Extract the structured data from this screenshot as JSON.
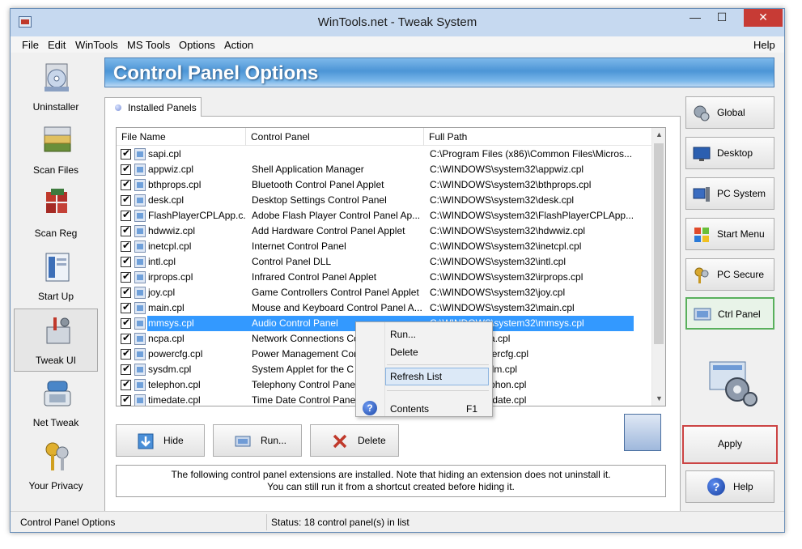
{
  "window": {
    "title": "WinTools.net - Tweak System",
    "min_glyph": "—",
    "max_glyph": "☐",
    "close_glyph": "✕"
  },
  "menu": {
    "items": [
      "File",
      "Edit",
      "WinTools",
      "MS Tools",
      "Options",
      "Action"
    ],
    "help": "Help"
  },
  "nav": {
    "items": [
      {
        "label": "Uninstaller",
        "icon": "uninstaller-icon"
      },
      {
        "label": "Scan Files",
        "icon": "scan-files-icon"
      },
      {
        "label": "Scan Reg",
        "icon": "scan-reg-icon"
      },
      {
        "label": "Start Up",
        "icon": "start-up-icon"
      },
      {
        "label": "Tweak UI",
        "icon": "tweak-ui-icon"
      },
      {
        "label": "Net Tweak",
        "icon": "net-tweak-icon"
      },
      {
        "label": "Your Privacy",
        "icon": "your-privacy-icon"
      }
    ],
    "active": "Tweak UI"
  },
  "banner": {
    "title": "Control Panel Options"
  },
  "tab": {
    "label": "Installed Panels"
  },
  "list": {
    "columns": [
      "File Name",
      "Control Panel",
      "Full Path"
    ],
    "rows": [
      {
        "name": "sapi.cpl",
        "cp": "",
        "path": "C:\\Program Files (x86)\\Common Files\\Micros..."
      },
      {
        "name": "appwiz.cpl",
        "cp": "Shell Application Manager",
        "path": "C:\\WINDOWS\\system32\\appwiz.cpl"
      },
      {
        "name": "bthprops.cpl",
        "cp": "Bluetooth Control Panel Applet",
        "path": "C:\\WINDOWS\\system32\\bthprops.cpl"
      },
      {
        "name": "desk.cpl",
        "cp": "Desktop Settings Control Panel",
        "path": "C:\\WINDOWS\\system32\\desk.cpl"
      },
      {
        "name": "FlashPlayerCPLApp.c...",
        "cp": "Adobe Flash Player Control Panel Ap...",
        "path": "C:\\WINDOWS\\system32\\FlashPlayerCPLApp...."
      },
      {
        "name": "hdwwiz.cpl",
        "cp": "Add Hardware Control Panel Applet",
        "path": "C:\\WINDOWS\\system32\\hdwwiz.cpl"
      },
      {
        "name": "inetcpl.cpl",
        "cp": "Internet Control Panel",
        "path": "C:\\WINDOWS\\system32\\inetcpl.cpl"
      },
      {
        "name": "intl.cpl",
        "cp": "Control Panel DLL",
        "path": "C:\\WINDOWS\\system32\\intl.cpl"
      },
      {
        "name": "irprops.cpl",
        "cp": "Infrared Control Panel Applet",
        "path": "C:\\WINDOWS\\system32\\irprops.cpl"
      },
      {
        "name": "joy.cpl",
        "cp": "Game Controllers Control Panel Applet",
        "path": "C:\\WINDOWS\\system32\\joy.cpl"
      },
      {
        "name": "main.cpl",
        "cp": "Mouse and Keyboard Control Panel A...",
        "path": "C:\\WINDOWS\\system32\\main.cpl"
      },
      {
        "name": "mmsys.cpl",
        "cp": "Audio Control Panel",
        "path": "C:\\WINDOWS\\system32\\mmsys.cpl",
        "selected": true
      },
      {
        "name": "ncpa.cpl",
        "cp": "Network Connections Co",
        "path": "system32\\ncpa.cpl"
      },
      {
        "name": "powercfg.cpl",
        "cp": "Power Management Cor",
        "path": "system32\\powercfg.cpl"
      },
      {
        "name": "sysdm.cpl",
        "cp": "System Applet for the C",
        "path": "system32\\sysdm.cpl"
      },
      {
        "name": "telephon.cpl",
        "cp": "Telephony Control Pane",
        "path": "system32\\telephon.cpl"
      },
      {
        "name": "timedate.cpl",
        "cp": "Time Date Control Panel",
        "path": "system32\\timedate.cpl"
      }
    ],
    "scroll_up_glyph": "▲",
    "scroll_down_glyph": "▼"
  },
  "context_menu": {
    "items": [
      "Run...",
      "Delete",
      "Refresh List",
      "Contents"
    ],
    "highlighted": "Refresh List",
    "contents_shortcut": "F1",
    "help_glyph": "?"
  },
  "actions": {
    "hide": "Hide",
    "run": "Run...",
    "delete": "Delete"
  },
  "info": {
    "line1": "The following control panel extensions are installed. Note that hiding an extension does not uninstall it.",
    "line2": "You can still run it from a shortcut created before hiding it."
  },
  "right_buttons": [
    "Global",
    "Desktop",
    "PC System",
    "Start Menu",
    "PC Secure",
    "Ctrl Panel"
  ],
  "right_active": "Ctrl Panel",
  "apply": "Apply",
  "help_button": {
    "label": "Help",
    "glyph": "?"
  },
  "status": {
    "left": "Control Panel Options",
    "right": "Status: 18 control panel(s) in list"
  },
  "colors": {
    "selection": "#3399ff",
    "banner": "#4c95d6",
    "apply_border": "#cc4444",
    "active_border": "#59b05c"
  }
}
